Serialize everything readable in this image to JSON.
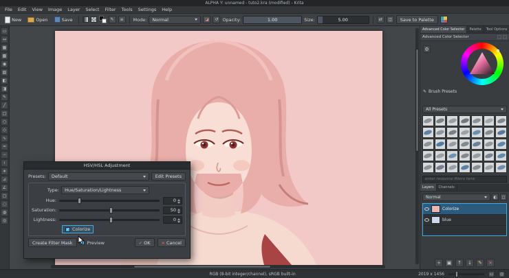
{
  "window": {
    "title": "ALPHA Y: unnamed - tuto2.kra (modified) - Krita"
  },
  "menu": {
    "items": [
      "File",
      "Edit",
      "View",
      "Image",
      "Layer",
      "Select",
      "Filter",
      "Tools",
      "Settings",
      "Help"
    ]
  },
  "toolbar": {
    "new_label": "New",
    "open_label": "Open",
    "save_label": "Save",
    "mode_label": "Mode:",
    "mode_value": "Normal",
    "opacity_label": "Opacity:",
    "opacity_value": "1.00",
    "size_label": "Size:",
    "size_value": "5.00",
    "save_to_palette_label": "Save to Palette"
  },
  "toolbox": {
    "tools": [
      {
        "name": "transform-tool",
        "glyph": "▭"
      },
      {
        "name": "move-tool",
        "glyph": "↔"
      },
      {
        "name": "crop-tool",
        "glyph": "▦"
      },
      {
        "name": "gradient-tool",
        "glyph": "▩"
      },
      {
        "name": "color-sampler-tool",
        "glyph": "◉"
      },
      {
        "name": "pattern-edit-tool",
        "glyph": "▨"
      },
      {
        "name": "fill-tool",
        "glyph": "◧"
      },
      {
        "name": "enclose-fill-tool",
        "glyph": "◨"
      },
      {
        "name": "freehand-brush-tool",
        "glyph": "✎"
      },
      {
        "name": "line-tool",
        "glyph": "╱"
      },
      {
        "name": "rectangle-tool",
        "glyph": "□"
      },
      {
        "name": "ellipse-tool",
        "glyph": "○"
      },
      {
        "name": "polygon-tool",
        "glyph": "◇"
      },
      {
        "name": "polyline-tool",
        "glyph": "∿"
      },
      {
        "name": "bezier-curve-tool",
        "glyph": "≈"
      },
      {
        "name": "freehand-path-tool",
        "glyph": "∽"
      },
      {
        "name": "dynamic-brush-tool",
        "glyph": "≀"
      },
      {
        "name": "multibrush-tool",
        "glyph": "∗"
      },
      {
        "name": "assistants-tool",
        "glyph": "⊿"
      },
      {
        "name": "measure-tool",
        "glyph": "∠"
      },
      {
        "name": "rectangular-selection-tool",
        "glyph": "▢"
      },
      {
        "name": "elliptical-selection-tool",
        "glyph": "◌"
      },
      {
        "name": "contiguous-selection-tool",
        "glyph": "◍"
      },
      {
        "name": "zoom-tool",
        "glyph": "◎"
      }
    ]
  },
  "dialog": {
    "title": "HSV/HSL Adjustment",
    "presets_label": "Presets:",
    "presets_value": "Default",
    "edit_presets_label": "Edit Presets",
    "type_label": "Type:",
    "type_value": "Hue/Saturation/Lightness",
    "sliders": [
      {
        "key": "hue",
        "label": "Hue:",
        "value": "0",
        "pos": 18
      },
      {
        "key": "saturation",
        "label": "Saturation:",
        "value": "50",
        "pos": 50
      },
      {
        "key": "lightness",
        "label": "Lightness:",
        "value": "0",
        "pos": 50
      }
    ],
    "colorize_label": "Colorize",
    "create_filter_mask_label": "Create Filter Mask",
    "preview_label": "Preview",
    "ok_label": "OK",
    "cancel_label": "Cancel"
  },
  "right_panel": {
    "tabs": [
      "Advanced Color Selector",
      "Palette",
      "Tool Options"
    ],
    "selector_title": "Advanced Color Selector",
    "brush_presets_label": "Brush Presets",
    "all_presets_label": "All Presets",
    "filter_placeholder": "enter resource filters here",
    "brush_presets": [
      "#8d949a",
      "#7b828a",
      "#98a0a6",
      "#6f7780",
      "#8a9298",
      "#a0a8ae",
      "#7f878e",
      "#5d83a6",
      "#8f979d",
      "#76808a",
      "#9aa2a8",
      "#6b90b2",
      "#848c92",
      "#59799c",
      "#8b9399",
      "#4f7ba2",
      "#969ea4",
      "#7e8890",
      "#68809a",
      "#8f979d",
      "#5c86ac",
      "#878f95",
      "#9aa2a8",
      "#6e93b5",
      "#81898f",
      "#949ca2",
      "#7a8691",
      "#638bb0",
      "#8c949a",
      "#75818d",
      "#97a0a6",
      "#5a80a4",
      "#868e94",
      "#9ba3a9",
      "#708faf"
    ],
    "layers_tabs": [
      "Layers",
      "Channels"
    ],
    "blend_mode": "Normal",
    "layers": [
      {
        "name": "Colorize",
        "selected": true,
        "thumb": "#e9b6b2"
      },
      {
        "name": "blue",
        "selected": false,
        "thumb": "#cdd9e6"
      }
    ],
    "layer_buttons": [
      {
        "name": "add-layer-button",
        "glyph": "+",
        "color": "#9fc4e0"
      },
      {
        "name": "duplicate-layer-button",
        "glyph": "▣",
        "color": "#c6cacd"
      },
      {
        "name": "move-layer-up-button",
        "glyph": "↑",
        "color": "#c6cacd"
      },
      {
        "name": "move-layer-down-button",
        "glyph": "↓",
        "color": "#c6cacd"
      },
      {
        "name": "layer-properties-button",
        "glyph": "✎",
        "color": "#e0c27f"
      },
      {
        "name": "delete-layer-button",
        "glyph": "×",
        "color": "#d98080"
      }
    ]
  },
  "statusbar": {
    "color_profile": "RGB (8-bit integer/channel), sRGB built-in",
    "canvas_size": "2019 x 1456"
  },
  "ui": {
    "check": "✓",
    "cross": "×"
  }
}
